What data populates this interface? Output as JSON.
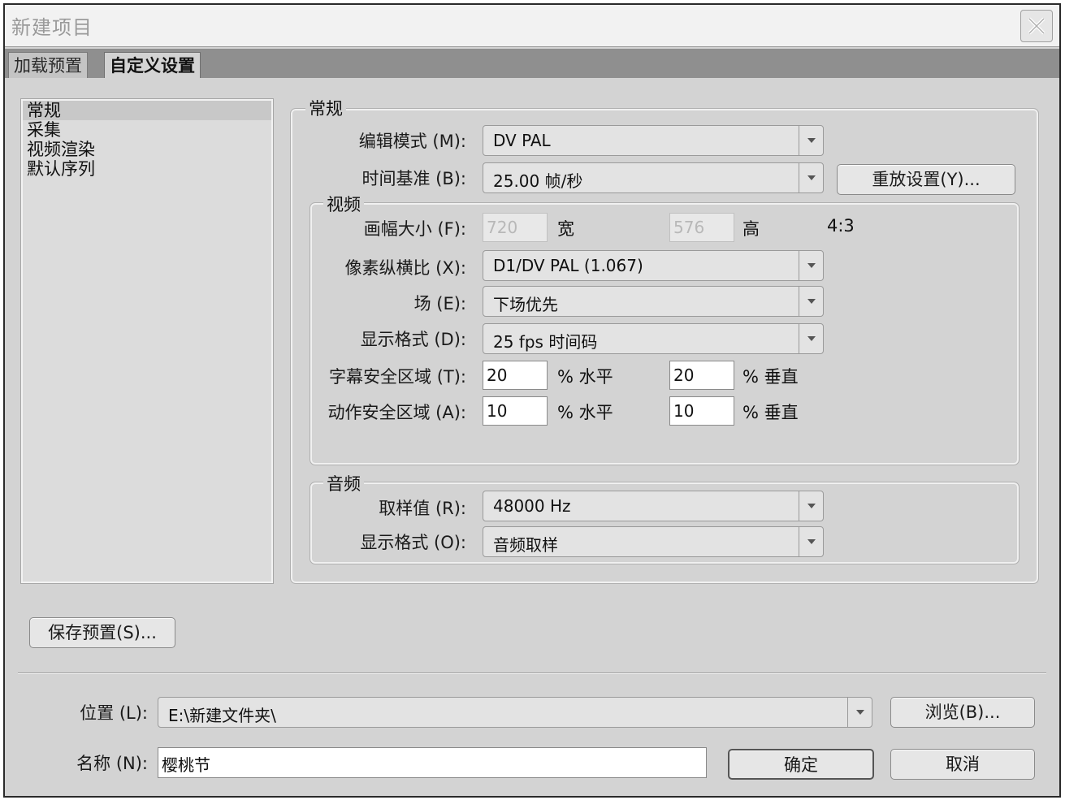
{
  "window": {
    "title": "新建项目"
  },
  "tabs": [
    {
      "label": "加载预置"
    },
    {
      "label": "自定义设置"
    }
  ],
  "sidebar": {
    "items": [
      {
        "label": "常规"
      },
      {
        "label": "采集"
      },
      {
        "label": "视频渲染"
      },
      {
        "label": "默认序列"
      }
    ]
  },
  "general": {
    "group_label": "常规",
    "edit_mode": {
      "label": "编辑模式 (M):",
      "value": "DV PAL"
    },
    "timebase": {
      "label": "时间基准 (B):",
      "value": "25.00 帧/秒"
    },
    "playback_button": "重放设置(Y)..."
  },
  "video": {
    "group_label": "视频",
    "frame_size": {
      "label": "画幅大小 (F):",
      "width": "720",
      "width_unit": "宽",
      "height": "576",
      "height_unit": "高",
      "aspect": "4:3"
    },
    "pixel_aspect": {
      "label": "像素纵横比 (X):",
      "value": "D1/DV PAL (1.067)"
    },
    "fields": {
      "label": "场 (E):",
      "value": "下场优先"
    },
    "display_format": {
      "label": "显示格式 (D):",
      "value": "25 fps 时间码"
    },
    "title_safe": {
      "label": "字幕安全区域 (T):",
      "h": "20",
      "h_unit": "% 水平",
      "v": "20",
      "v_unit": "% 垂直"
    },
    "action_safe": {
      "label": "动作安全区域 (A):",
      "h": "10",
      "h_unit": "% 水平",
      "v": "10",
      "v_unit": "% 垂直"
    }
  },
  "audio": {
    "group_label": "音频",
    "sample_rate": {
      "label": "取样值 (R):",
      "value": "48000 Hz"
    },
    "display_format": {
      "label": "显示格式 (O):",
      "value": "音频取样"
    }
  },
  "save_preset_button": "保存预置(S)...",
  "location": {
    "label": "位置 (L):",
    "value": "E:\\新建文件夹\\",
    "browse_button": "浏览(B)..."
  },
  "name": {
    "label": "名称 (N):",
    "value": "樱桃节"
  },
  "ok_button": "确定",
  "cancel_button": "取消"
}
